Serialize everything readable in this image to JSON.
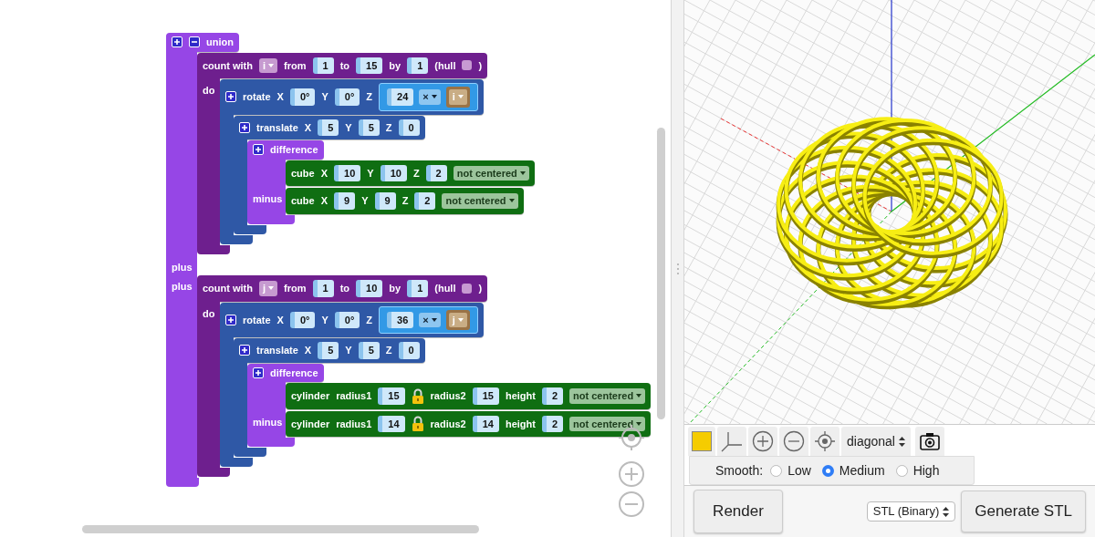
{
  "workspace": {
    "blocks": [
      {
        "kind": "union",
        "header": [
          {
            "kind": "plus"
          },
          {
            "kind": "minus"
          },
          {
            "kind": "label",
            "text": "union"
          }
        ],
        "statements": [
          {
            "blocks": [
              {
                "kind": "loop",
                "header": [
                  {
                    "kind": "label",
                    "text": "count with"
                  },
                  {
                    "kind": "loopvar",
                    "text": "i"
                  },
                  {
                    "kind": "label",
                    "text": "from"
                  },
                  {
                    "kind": "number",
                    "text": "1"
                  },
                  {
                    "kind": "label",
                    "text": "to"
                  },
                  {
                    "kind": "number",
                    "text": "15"
                  },
                  {
                    "kind": "label",
                    "text": "by"
                  },
                  {
                    "kind": "number",
                    "text": "1"
                  },
                  {
                    "kind": "label",
                    "text": "(hull"
                  },
                  {
                    "kind": "checkbox",
                    "checked": false
                  },
                  {
                    "kind": "label",
                    "text": ")"
                  }
                ],
                "statements": [
                  {
                    "label": "do",
                    "blocks": [
                      {
                        "kind": "transform",
                        "header": [
                          {
                            "kind": "plus"
                          },
                          {
                            "kind": "label",
                            "text": "rotate"
                          },
                          {
                            "kind": "label",
                            "text": "X"
                          },
                          {
                            "kind": "number",
                            "text": "0°"
                          },
                          {
                            "kind": "label",
                            "text": "Y"
                          },
                          {
                            "kind": "number",
                            "text": "0°"
                          },
                          {
                            "kind": "label",
                            "text": "Z"
                          },
                          {
                            "kind": "expr",
                            "items": [
                              {
                                "kind": "number",
                                "text": "24"
                              },
                              {
                                "kind": "operator",
                                "text": "×"
                              },
                              {
                                "kind": "variable",
                                "text": "i"
                              }
                            ]
                          }
                        ],
                        "statements": [
                          {
                            "blocks": [
                              {
                                "kind": "transform",
                                "header": [
                                  {
                                    "kind": "plus"
                                  },
                                  {
                                    "kind": "label",
                                    "text": "translate"
                                  },
                                  {
                                    "kind": "label",
                                    "text": "X"
                                  },
                                  {
                                    "kind": "number",
                                    "text": "5"
                                  },
                                  {
                                    "kind": "label",
                                    "text": "Y"
                                  },
                                  {
                                    "kind": "number",
                                    "text": "5"
                                  },
                                  {
                                    "kind": "label",
                                    "text": "Z"
                                  },
                                  {
                                    "kind": "number",
                                    "text": "0"
                                  }
                                ],
                                "statements": [
                                  {
                                    "blocks": [
                                      {
                                        "kind": "csg",
                                        "header": [
                                          {
                                            "kind": "plus"
                                          },
                                          {
                                            "kind": "label",
                                            "text": "difference"
                                          }
                                        ],
                                        "statements": [
                                          {
                                            "blocks": [
                                              {
                                                "kind": "shape",
                                                "header": [
                                                  {
                                                    "kind": "label",
                                                    "text": "cube"
                                                  },
                                                  {
                                                    "kind": "label",
                                                    "text": "X"
                                                  },
                                                  {
                                                    "kind": "number",
                                                    "text": "10"
                                                  },
                                                  {
                                                    "kind": "label",
                                                    "text": "Y"
                                                  },
                                                  {
                                                    "kind": "number",
                                                    "text": "10"
                                                  },
                                                  {
                                                    "kind": "label",
                                                    "text": "Z"
                                                  },
                                                  {
                                                    "kind": "number",
                                                    "text": "2"
                                                  },
                                                  {
                                                    "kind": "dropdown",
                                                    "text": "not centered"
                                                  }
                                                ]
                                              }
                                            ]
                                          },
                                          {
                                            "label": "minus",
                                            "blocks": [
                                              {
                                                "kind": "shape",
                                                "header": [
                                                  {
                                                    "kind": "label",
                                                    "text": "cube"
                                                  },
                                                  {
                                                    "kind": "label",
                                                    "text": "X"
                                                  },
                                                  {
                                                    "kind": "number",
                                                    "text": "9"
                                                  },
                                                  {
                                                    "kind": "label",
                                                    "text": "Y"
                                                  },
                                                  {
                                                    "kind": "number",
                                                    "text": "9"
                                                  },
                                                  {
                                                    "kind": "label",
                                                    "text": "Z"
                                                  },
                                                  {
                                                    "kind": "number",
                                                    "text": "2"
                                                  },
                                                  {
                                                    "kind": "dropdown",
                                                    "text": "not centered"
                                                  }
                                                ]
                                              }
                                            ]
                                          }
                                        ]
                                      }
                                    ]
                                  }
                                ]
                              }
                            ]
                          }
                        ]
                      }
                    ]
                  }
                ]
              }
            ]
          },
          {
            "label": "plus"
          },
          {
            "label": "plus",
            "blocks": [
              {
                "kind": "loop",
                "header": [
                  {
                    "kind": "label",
                    "text": "count with"
                  },
                  {
                    "kind": "loopvar",
                    "text": "j"
                  },
                  {
                    "kind": "label",
                    "text": "from"
                  },
                  {
                    "kind": "number",
                    "text": "1"
                  },
                  {
                    "kind": "label",
                    "text": "to"
                  },
                  {
                    "kind": "number",
                    "text": "10"
                  },
                  {
                    "kind": "label",
                    "text": "by"
                  },
                  {
                    "kind": "number",
                    "text": "1"
                  },
                  {
                    "kind": "label",
                    "text": "(hull"
                  },
                  {
                    "kind": "checkbox",
                    "checked": false
                  },
                  {
                    "kind": "label",
                    "text": ")"
                  }
                ],
                "statements": [
                  {
                    "label": "do",
                    "blocks": [
                      {
                        "kind": "transform",
                        "header": [
                          {
                            "kind": "plus"
                          },
                          {
                            "kind": "label",
                            "text": "rotate"
                          },
                          {
                            "kind": "label",
                            "text": "X"
                          },
                          {
                            "kind": "number",
                            "text": "0°"
                          },
                          {
                            "kind": "label",
                            "text": "Y"
                          },
                          {
                            "kind": "number",
                            "text": "0°"
                          },
                          {
                            "kind": "label",
                            "text": "Z"
                          },
                          {
                            "kind": "expr",
                            "items": [
                              {
                                "kind": "number",
                                "text": "36"
                              },
                              {
                                "kind": "operator",
                                "text": "×"
                              },
                              {
                                "kind": "variable",
                                "text": "j"
                              }
                            ]
                          }
                        ],
                        "statements": [
                          {
                            "blocks": [
                              {
                                "kind": "transform",
                                "header": [
                                  {
                                    "kind": "plus"
                                  },
                                  {
                                    "kind": "label",
                                    "text": "translate"
                                  },
                                  {
                                    "kind": "label",
                                    "text": "X"
                                  },
                                  {
                                    "kind": "number",
                                    "text": "5"
                                  },
                                  {
                                    "kind": "label",
                                    "text": "Y"
                                  },
                                  {
                                    "kind": "number",
                                    "text": "5"
                                  },
                                  {
                                    "kind": "label",
                                    "text": "Z"
                                  },
                                  {
                                    "kind": "number",
                                    "text": "0"
                                  }
                                ],
                                "statements": [
                                  {
                                    "blocks": [
                                      {
                                        "kind": "csg",
                                        "header": [
                                          {
                                            "kind": "plus"
                                          },
                                          {
                                            "kind": "label",
                                            "text": "difference"
                                          }
                                        ],
                                        "statements": [
                                          {
                                            "blocks": [
                                              {
                                                "kind": "shape",
                                                "header": [
                                                  {
                                                    "kind": "label",
                                                    "text": "cylinder"
                                                  },
                                                  {
                                                    "kind": "label",
                                                    "text": "radius1"
                                                  },
                                                  {
                                                    "kind": "number",
                                                    "text": "15"
                                                  },
                                                  {
                                                    "kind": "lock"
                                                  },
                                                  {
                                                    "kind": "label",
                                                    "text": "radius2"
                                                  },
                                                  {
                                                    "kind": "number",
                                                    "text": "15"
                                                  },
                                                  {
                                                    "kind": "label",
                                                    "text": "height"
                                                  },
                                                  {
                                                    "kind": "number",
                                                    "text": "2"
                                                  },
                                                  {
                                                    "kind": "dropdown",
                                                    "text": "not centered"
                                                  }
                                                ]
                                              }
                                            ]
                                          },
                                          {
                                            "label": "minus",
                                            "blocks": [
                                              {
                                                "kind": "shape",
                                                "header": [
                                                  {
                                                    "kind": "label",
                                                    "text": "cylinder"
                                                  },
                                                  {
                                                    "kind": "label",
                                                    "text": "radius1"
                                                  },
                                                  {
                                                    "kind": "number",
                                                    "text": "14"
                                                  },
                                                  {
                                                    "kind": "lock"
                                                  },
                                                  {
                                                    "kind": "label",
                                                    "text": "radius2"
                                                  },
                                                  {
                                                    "kind": "number",
                                                    "text": "14"
                                                  },
                                                  {
                                                    "kind": "label",
                                                    "text": "height"
                                                  },
                                                  {
                                                    "kind": "number",
                                                    "text": "2"
                                                  },
                                                  {
                                                    "kind": "dropdown",
                                                    "text": "not centered"
                                                  }
                                                ]
                                              }
                                            ]
                                          }
                                        ]
                                      }
                                    ]
                                  }
                                ]
                              }
                            ]
                          }
                        ]
                      }
                    ]
                  }
                ]
              }
            ]
          }
        ]
      }
    ]
  },
  "viewer": {
    "view_select": "diagonal",
    "smooth": {
      "label": "Smooth:",
      "options": [
        {
          "label": "Low",
          "selected": false
        },
        {
          "label": "Medium",
          "selected": true
        },
        {
          "label": "High",
          "selected": false
        }
      ]
    },
    "render_button": "Render",
    "format_select": "STL (Binary)",
    "generate_button": "Generate STL"
  }
}
